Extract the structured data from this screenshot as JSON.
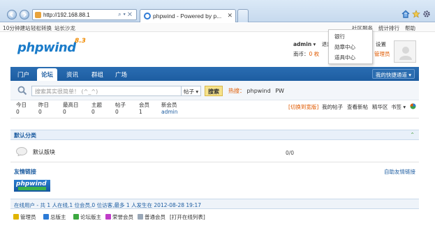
{
  "browser": {
    "address": "http://192.168.88.1",
    "tab_title": "phpwind - Powered by p..."
  },
  "toplinks": {
    "left": [
      "10分钟建站",
      "轻松转换",
      "站长沙龙"
    ],
    "right": [
      "社区服务",
      "统计排行",
      "帮助"
    ]
  },
  "logo": {
    "text": "phpwind",
    "version": "8.3"
  },
  "user": {
    "name": "admin",
    "logout": "退出",
    "credit_label": "南币：",
    "credit_value": "0 枚",
    "settings": "设置",
    "role": "管理员"
  },
  "dropdown": [
    "银行",
    "勋章中心",
    "道具中心"
  ],
  "nav": {
    "items": [
      "门户",
      "论坛",
      "资讯",
      "群组",
      "广场"
    ],
    "quick": "我的快捷通道"
  },
  "search": {
    "placeholder": "搜索其实很简单！ (^_^)",
    "type": "帖子",
    "button": "搜索",
    "hot_label": "热搜：",
    "hot_terms": [
      "phpwind",
      "PW"
    ]
  },
  "stats": [
    {
      "label": "今日",
      "value": "0"
    },
    {
      "label": "昨日",
      "value": "0"
    },
    {
      "label": "最高日",
      "value": "0"
    },
    {
      "label": "主题",
      "value": "0"
    },
    {
      "label": "帖子",
      "value": "0"
    },
    {
      "label": "会员",
      "value": "1"
    },
    {
      "label": "新会员",
      "value": "admin"
    }
  ],
  "stat_links": {
    "switch": "[切换到宽版]",
    "mine": "我的帖子",
    "newest": "查看新帖",
    "elite": "精华区",
    "bookmarks": "书签"
  },
  "sections": {
    "default_title": "默认分类",
    "forum_name": "默认版块",
    "forum_counts": "0/0",
    "friend_title": "友情链接",
    "friend_right": "自助友情链接"
  },
  "online": "在线用户 - 共 1 人在线,1 位会员,0 位访客,最多 1 人发生在 2012-08-28 19:17",
  "legend": [
    {
      "label": "管理员",
      "color": "#e0b400"
    },
    {
      "label": "总版主",
      "color": "#2c7bd6"
    },
    {
      "label": "论坛版主",
      "color": "#3ca840"
    },
    {
      "label": "荣誉会员",
      "color": "#c03cc8"
    },
    {
      "label": "普通会员",
      "color": "#9aa8b8"
    },
    {
      "label": "[打开在线列表]",
      "color": ""
    }
  ]
}
